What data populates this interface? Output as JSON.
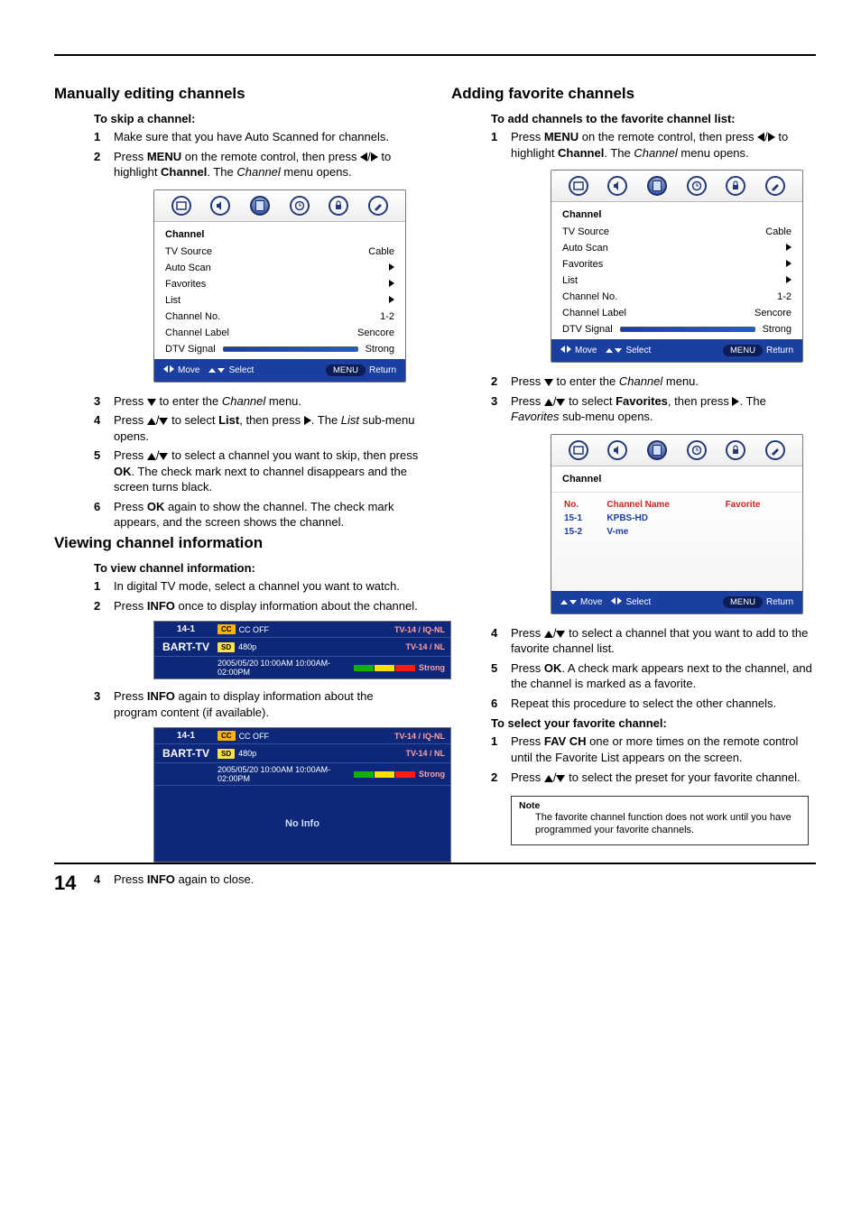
{
  "page_number": "14",
  "left": {
    "h_manual": "Manually editing channels",
    "sub_skip": "To skip a channel:",
    "manual_steps": [
      "Make sure that you have Auto Scanned for channels.",
      "Press <b>MENU</b> on the remote control, then press <tri-left>/<tri-right> to highlight <b>Channel</b>. The <i>Channel</i> menu opens.",
      "Press <tri-down> to enter the <i>Channel</i> menu.",
      "Press <tri-up>/<tri-down> to select <b>List</b>, then press <tri-right>. The <i>List</i> sub-menu opens.",
      "Press <tri-up>/<tri-down> to select a channel you want to skip, then press <b>OK</b>. The check mark next to channel disappears and the screen turns black.",
      "Press <b>OK</b> again to show the channel. The check mark appears, and the screen shows the channel."
    ],
    "h_view": "Viewing channel information",
    "sub_view": "To view channel information:",
    "view_steps": [
      "In digital TV mode, select a channel you want to watch.",
      "Press <b>INFO</b> once to display information about the channel.",
      "Press <b>INFO</b> again to display information about the program content (if available).",
      "Press <b>INFO</b> again to close."
    ]
  },
  "right": {
    "h_fav": "Adding favorite channels",
    "sub_add": "To add channels to the favorite channel list:",
    "add_steps": [
      "Press <b>MENU</b> on the remote control, then press <tri-left>/<tri-right> to highlight <b>Channel</b>. The <i>Channel</i> menu opens.",
      "Press <tri-down> to enter the <i>Channel</i> menu.",
      "Press <tri-up>/<tri-down> to select <b>Favorites</b>, then press <tri-right>. The <i>Favorites</i> sub-menu opens.",
      "Press <tri-up>/<tri-down> to select a channel that you want to add to the favorite channel list.",
      "Press <b>OK</b>. A check mark appears next to the channel, and the channel is marked as a favorite.",
      "Repeat this procedure to select the other channels."
    ],
    "sub_sel": "To select your favorite channel:",
    "sel_steps": [
      "Press <b>FAV CH</b> one or more times on the remote control until the Favorite List appears on the screen.",
      "Press <tri-up>/<tri-down> to select the preset for your favorite channel."
    ],
    "note_title": "Note",
    "note_body": "The favorite channel function does not work until you have programmed your favorite channels."
  },
  "osd_channel": {
    "title": "Channel",
    "rows": [
      {
        "label": "TV Source",
        "value": "Cable"
      },
      {
        "label": "Auto Scan",
        "value": "▶"
      },
      {
        "label": "Favorites",
        "value": "▶"
      },
      {
        "label": "List",
        "value": "▶"
      },
      {
        "label": "Channel No.",
        "value": "1-2"
      },
      {
        "label": "Channel Label",
        "value": "Sencore"
      },
      {
        "label": "DTV Signal",
        "value": "Strong",
        "bar": true
      }
    ],
    "footer": {
      "move": "Move",
      "select": "Select",
      "menu": "MENU",
      "return": "Return"
    }
  },
  "osd_fav": {
    "title": "Channel",
    "headers": {
      "no": "No.",
      "name": "Channel Name",
      "fav": "Favorite"
    },
    "rows": [
      {
        "no": "15-1",
        "name": "KPBS-HD"
      },
      {
        "no": "15-2",
        "name": "V-me"
      }
    ],
    "footer": {
      "move": "Move",
      "select": "Select",
      "menu": "MENU",
      "return": "Return"
    }
  },
  "banner": {
    "ch_no": "14-1",
    "ch_name": "BART-TV",
    "cc_label": "CC",
    "cc_state": "CC  OFF",
    "rating1": "TV-14 / IQ-NL",
    "sd_label": "SD",
    "res": "480p",
    "rating2": "TV-14 / NL",
    "time": "2005/05/20 10:00AM 10:00AM-02:00PM",
    "signal": "Strong",
    "noinfo": "No Info"
  }
}
